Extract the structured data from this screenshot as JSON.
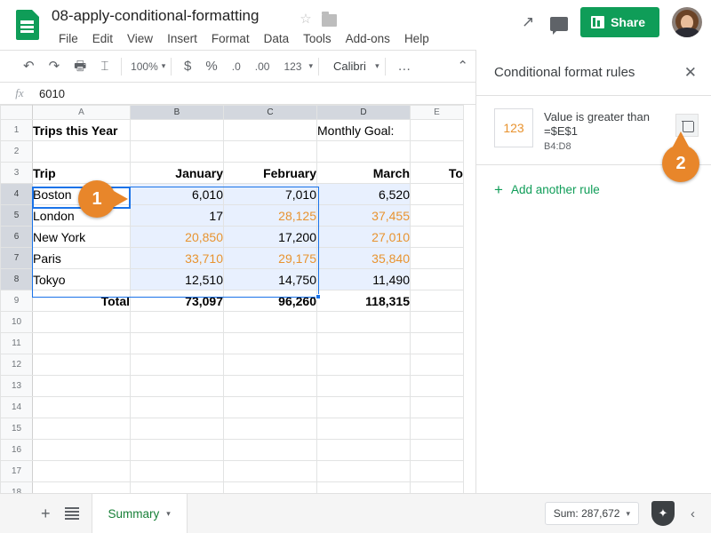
{
  "app": {
    "doc_title": "08-apply-conditional-formatting",
    "logo_icon": "sheets-logo-icon",
    "star_icon": "star-icon",
    "folder_icon": "folder-icon"
  },
  "menubar": {
    "items": [
      "File",
      "Edit",
      "View",
      "Insert",
      "Format",
      "Data",
      "Tools",
      "Add-ons",
      "Help"
    ]
  },
  "top_actions": {
    "trending_icon": "trending-up-icon",
    "comment_icon": "comment-icon",
    "share_label": "Share",
    "share_icon": "lock-icon",
    "avatar": "user-avatar",
    "share_color": "#0f9d58"
  },
  "toolbar": {
    "undo": "↶",
    "redo": "↷",
    "print": "🖶",
    "paint": "⌶",
    "zoom_value": "100%",
    "currency": "$",
    "percent": "%",
    "dec_decrease": ".0",
    "dec_increase": ".00",
    "number_format": "123",
    "font_name": "Calibri",
    "more": "…",
    "collapse": "⌃"
  },
  "formula_bar": {
    "fx_label": "fx",
    "value": "6010"
  },
  "grid": {
    "columns": [
      "A",
      "B",
      "C",
      "D",
      "E"
    ],
    "selected_columns": [
      "B",
      "C",
      "D"
    ],
    "selected_rows": [
      4,
      5,
      6,
      7,
      8
    ],
    "rows": [
      {
        "n": 1,
        "cells": [
          {
            "t": "Trips this Year",
            "bold": true
          },
          {
            "t": ""
          },
          {
            "t": ""
          },
          {
            "t": "Monthly Goal:"
          },
          {
            "t": ""
          }
        ]
      },
      {
        "n": 2,
        "cells": [
          {
            "t": ""
          },
          {
            "t": ""
          },
          {
            "t": ""
          },
          {
            "t": ""
          },
          {
            "t": ""
          }
        ]
      },
      {
        "n": 3,
        "cells": [
          {
            "t": "Trip",
            "bold": true
          },
          {
            "t": "January",
            "bold": true,
            "align": "r"
          },
          {
            "t": "February",
            "bold": true,
            "align": "r"
          },
          {
            "t": "March",
            "bold": true,
            "align": "r"
          },
          {
            "t": "To",
            "bold": true,
            "align": "r"
          }
        ]
      },
      {
        "n": 4,
        "cells": [
          {
            "t": "Boston"
          },
          {
            "t": "6,010",
            "align": "r",
            "sel": true
          },
          {
            "t": "7,010",
            "align": "r",
            "sel": true
          },
          {
            "t": "6,520",
            "align": "r",
            "sel": true
          },
          {
            "t": ""
          }
        ]
      },
      {
        "n": 5,
        "cells": [
          {
            "t": "London"
          },
          {
            "t": "17",
            "align": "r",
            "sel": true
          },
          {
            "t": "28,125",
            "align": "r",
            "sel": true,
            "cf": true
          },
          {
            "t": "37,455",
            "align": "r",
            "sel": true,
            "cf": true
          },
          {
            "t": ""
          }
        ]
      },
      {
        "n": 6,
        "cells": [
          {
            "t": "New York"
          },
          {
            "t": "20,850",
            "align": "r",
            "sel": true,
            "cf": true
          },
          {
            "t": "17,200",
            "align": "r",
            "sel": true
          },
          {
            "t": "27,010",
            "align": "r",
            "sel": true,
            "cf": true
          },
          {
            "t": ""
          }
        ]
      },
      {
        "n": 7,
        "cells": [
          {
            "t": "Paris"
          },
          {
            "t": "33,710",
            "align": "r",
            "sel": true,
            "cf": true
          },
          {
            "t": "29,175",
            "align": "r",
            "sel": true,
            "cf": true
          },
          {
            "t": "35,840",
            "align": "r",
            "sel": true,
            "cf": true
          },
          {
            "t": ""
          }
        ]
      },
      {
        "n": 8,
        "cells": [
          {
            "t": "Tokyo"
          },
          {
            "t": "12,510",
            "align": "r",
            "sel": true
          },
          {
            "t": "14,750",
            "align": "r",
            "sel": true
          },
          {
            "t": "11,490",
            "align": "r",
            "sel": true
          },
          {
            "t": ""
          }
        ]
      },
      {
        "n": 9,
        "cells": [
          {
            "t": "Total",
            "bold": true,
            "align": "r"
          },
          {
            "t": "73,097",
            "bold": true,
            "align": "r"
          },
          {
            "t": "96,260",
            "bold": true,
            "align": "r"
          },
          {
            "t": "118,315",
            "bold": true,
            "align": "r"
          },
          {
            "t": ""
          }
        ]
      },
      {
        "n": 10,
        "cells": [
          {
            "t": ""
          },
          {
            "t": ""
          },
          {
            "t": ""
          },
          {
            "t": ""
          },
          {
            "t": ""
          }
        ]
      },
      {
        "n": 11,
        "cells": [
          {
            "t": ""
          },
          {
            "t": ""
          },
          {
            "t": ""
          },
          {
            "t": ""
          },
          {
            "t": ""
          }
        ]
      },
      {
        "n": 12,
        "cells": [
          {
            "t": ""
          },
          {
            "t": ""
          },
          {
            "t": ""
          },
          {
            "t": ""
          },
          {
            "t": ""
          }
        ]
      },
      {
        "n": 13,
        "cells": [
          {
            "t": ""
          },
          {
            "t": ""
          },
          {
            "t": ""
          },
          {
            "t": ""
          },
          {
            "t": ""
          }
        ]
      },
      {
        "n": 14,
        "cells": [
          {
            "t": ""
          },
          {
            "t": ""
          },
          {
            "t": ""
          },
          {
            "t": ""
          },
          {
            "t": ""
          }
        ]
      },
      {
        "n": 15,
        "cells": [
          {
            "t": ""
          },
          {
            "t": ""
          },
          {
            "t": ""
          },
          {
            "t": ""
          },
          {
            "t": ""
          }
        ]
      },
      {
        "n": 16,
        "cells": [
          {
            "t": ""
          },
          {
            "t": ""
          },
          {
            "t": ""
          },
          {
            "t": ""
          },
          {
            "t": ""
          }
        ]
      },
      {
        "n": 17,
        "cells": [
          {
            "t": ""
          },
          {
            "t": ""
          },
          {
            "t": ""
          },
          {
            "t": ""
          },
          {
            "t": ""
          }
        ]
      },
      {
        "n": 18,
        "cells": [
          {
            "t": ""
          },
          {
            "t": ""
          },
          {
            "t": ""
          },
          {
            "t": ""
          },
          {
            "t": ""
          }
        ]
      }
    ],
    "active_cell": "B4",
    "conditional_color": "#e8932f",
    "selection_color": "#1a73e8",
    "selection_fill": "#e8f0fe"
  },
  "sidebar": {
    "title": "Conditional format rules",
    "close_icon": "close-icon",
    "rule": {
      "swatch_text": "123",
      "condition": "Value is greater than",
      "formula": "=$E$1",
      "range": "B4:D8",
      "delete_icon": "trash-icon"
    },
    "add_rule_label": "Add another rule",
    "add_rule_icon": "plus-icon"
  },
  "callouts": [
    {
      "id": "1",
      "label": "1"
    },
    {
      "id": "2",
      "label": "2"
    }
  ],
  "bottombar": {
    "add_sheet_icon": "plus-icon",
    "all_sheets_icon": "sheets-list-icon",
    "sheet_tab": "Summary",
    "sheet_caret": "▾",
    "sum_label": "Sum: 287,672",
    "sum_caret": "▾",
    "explore_icon": "explore-icon",
    "collapse_icon": "chevron-left-icon"
  }
}
